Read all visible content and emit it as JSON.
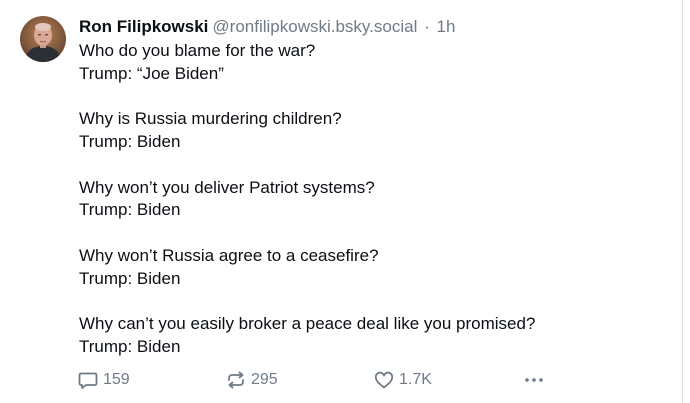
{
  "post": {
    "author": {
      "display_name": "Ron Filipkowski",
      "handle": "@ronfilipkowski.bsky.social",
      "separator": "·",
      "time": "1h"
    },
    "lines": [
      "Who do you blame for the war?",
      "Trump: “Joe Biden”",
      "",
      "Why is Russia murdering children?",
      "Trump: Biden",
      "",
      "Why won’t you deliver Patriot systems?",
      "Trump: Biden",
      "",
      "Why won’t Russia agree to a ceasefire?",
      "Trump: Biden",
      "",
      "Why can’t you easily broker a peace deal like you promised?",
      "Trump: Biden"
    ],
    "stats": {
      "replies": "159",
      "reposts": "295",
      "likes": "1.7K"
    }
  },
  "icons": {
    "reply": "speech-bubble-icon",
    "repost": "repost-arrows-icon",
    "like": "heart-icon",
    "more": "ellipsis-icon"
  },
  "colors": {
    "text": "#0b0f14",
    "muted": "#6f7b87",
    "divider": "#d9dee3"
  }
}
